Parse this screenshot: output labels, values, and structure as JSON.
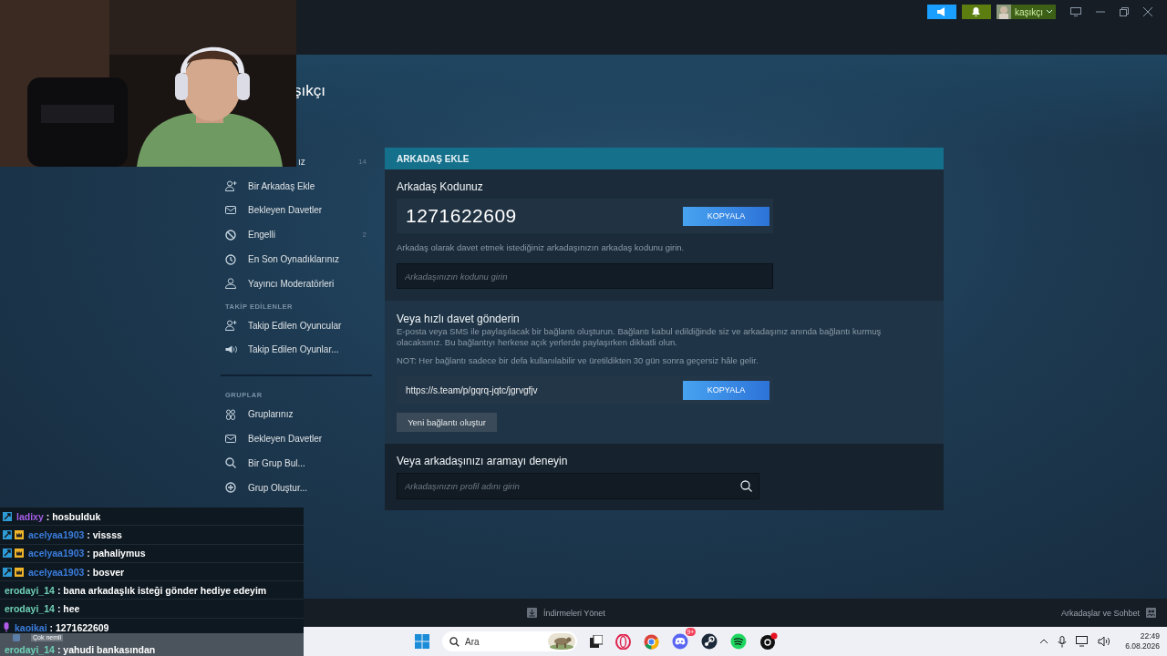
{
  "top_bar": {
    "account": {
      "name": "kaşıkçı"
    }
  },
  "profile": {
    "name": "şıkçı"
  },
  "nav": {
    "sections": [
      {
        "items": [
          {
            "label": "ız",
            "count": "14"
          },
          {
            "label": "Bir Arkadaş Ekle"
          },
          {
            "label": "Bekleyen Davetler"
          },
          {
            "label": "Engelli",
            "count": "2"
          },
          {
            "label": "En Son Oynadıklarınız"
          },
          {
            "label": "Yayıncı Moderatörleri"
          }
        ]
      },
      {
        "title": "TAKİP EDİLENLER",
        "items": [
          {
            "label": "Takip Edilen Oyuncular"
          },
          {
            "label": "Takip Edilen Oyunlar..."
          }
        ]
      },
      {
        "title": "GRUPLAR",
        "items": [
          {
            "label": "Gruplarınız"
          },
          {
            "label": "Bekleyen Davetler"
          },
          {
            "label": "Bir Grup Bul..."
          },
          {
            "label": "Grup Oluştur..."
          }
        ]
      }
    ]
  },
  "add_friend": {
    "header": "ARKADAŞ EKLE",
    "code_section": {
      "title": "Arkadaş Kodunuz",
      "code": "1271622609",
      "copy_button": "KOPYALA",
      "hint": "Arkadaş olarak davet etmek istediğiniz arkadaşınızın arkadaş kodunu girin.",
      "placeholder": "Arkadaşınızın kodunu girin"
    },
    "invite_section": {
      "title": "Veya hızlı davet gönderin",
      "description": "E-posta veya SMS ile paylaşılacak bir bağlantı oluşturun. Bağlantı kabul edildiğinde siz ve arkadaşınız anında bağlantı kurmuş olacaksınız. Bu bağlantıyı herkese açık yerlerde paylaşırken dikkatli olun.",
      "note": "NOT: Her bağlantı sadece bir defa kullanılabilir ve üretildikten 30 gün sonra geçersiz hâle gelir.",
      "link": "https://s.team/p/gqrq-jqtc/jgrvgfjv",
      "copy_button": "KOPYALA",
      "new_link_button": "Yeni bağlantı oluştur"
    },
    "search_section": {
      "title": "Veya arkadaşınızı aramayı deneyin",
      "placeholder": "Arkadaşınızın profil adını girin"
    }
  },
  "chat": [
    {
      "user": "ladixy",
      "color": "#a45ee5",
      "text": ": hosbulduk",
      "moderator": true,
      "vip": false,
      "speaker": false
    },
    {
      "user": "acelyaa1903",
      "color": "#3b7ddd",
      "text": ": vissss",
      "moderator": true,
      "vip": true,
      "speaker": false
    },
    {
      "user": "acelyaa1903",
      "color": "#3b7ddd",
      "text": ": pahaliymus",
      "moderator": true,
      "vip": true,
      "speaker": false
    },
    {
      "user": "acelyaa1903",
      "color": "#3b7ddd",
      "text": ": bosver",
      "moderator": true,
      "vip": true,
      "speaker": false
    },
    {
      "user": "erodayi_14",
      "color": "#6fd0b6",
      "text": ": bana arkadaşlık isteği gönder hediye edeyim",
      "moderator": false,
      "vip": false,
      "speaker": false
    },
    {
      "user": "erodayi_14",
      "color": "#6fd0b6",
      "text": ": hee",
      "moderator": false,
      "vip": false,
      "speaker": false
    },
    {
      "user": "kaoikai",
      "color": "#3b7ddd",
      "text": ": 1271622609",
      "moderator": false,
      "vip": false,
      "speaker": true
    },
    {
      "user": "erodayi_14",
      "color": "#6fd0b6",
      "text": ": yahudi bankasından",
      "moderator": false,
      "vip": false,
      "speaker": false
    }
  ],
  "overlay_notice": {
    "text": "Çok nemli"
  },
  "steam_footer": {
    "downloads": "İndirmeleri Yönet",
    "friends": "Arkadaşlar ve Sohbet"
  },
  "taskbar": {
    "search_placeholder": "Ara",
    "discord_badge": "9+",
    "time": "22:49",
    "date": "6.08.2026"
  }
}
